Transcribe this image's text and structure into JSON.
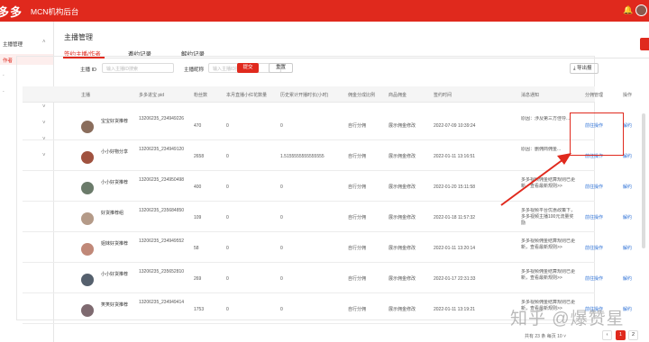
{
  "topbar": {
    "logo": "多多",
    "title": "MCN机构后台",
    "bell_icon": "bell-icon"
  },
  "sidebar": {
    "items": [
      {
        "label": "主播管理",
        "active": false,
        "chevron": "^"
      },
      {
        "label": "作者",
        "active": true,
        "chevron": ""
      },
      {
        "label": "",
        "active": false,
        "chevron": ""
      },
      {
        "label": "",
        "active": false,
        "chevron": ""
      },
      {
        "label": "",
        "active": false,
        "chevron": "v"
      },
      {
        "label": "",
        "active": false,
        "chevron": "v"
      },
      {
        "label": "",
        "active": false,
        "chevron": "v"
      },
      {
        "label": "",
        "active": false,
        "chevron": "v"
      }
    ]
  },
  "page": {
    "title": "主播管理"
  },
  "tabs": [
    "签约主播/作者",
    "邀约记录",
    "解约记录"
  ],
  "filters": {
    "id_label": "主播 ID",
    "id_placeholder": "输入主播ID搜索",
    "nick_label": "主播昵称",
    "nick_placeholder": "输入主播ID搜索",
    "submit": "提交",
    "reset": "重置",
    "export": "导出报"
  },
  "table": {
    "headers": [
      "主播",
      "多多进宝 pid",
      "粉丝数",
      "本月直播小红花数量",
      "历史累计开播时长(小时)",
      "佣金分成比例",
      "商品佣金",
      "签约时间",
      "消息通知",
      "分佣管理",
      "操作"
    ],
    "rows": [
      {
        "name": "宝宝好货推荐",
        "pid": "13206235_234949226",
        "fans": "470",
        "flowers": "0",
        "hours": "0",
        "ratio": "自行分佣",
        "commission": "展示佣金修改",
        "time": "2022-07-09 10:39:24",
        "notice": "原因：涉及第三方佳导...",
        "manage": "前往操作",
        "op": "解约",
        "avatar": "#8a6d5c"
      },
      {
        "name": "小小好物分享",
        "pid": "13206235_234949120",
        "fans": "2658",
        "flowers": "0",
        "hours": "1.5155555555555555",
        "ratio": "自行分佣",
        "commission": "展示佣金修改",
        "time": "2022-01-11 13:16:51",
        "notice": "原因：删佣商佣金...",
        "manage": "前往操作",
        "op": "解约",
        "avatar": "#a0523f"
      },
      {
        "name": "小小好货推荐",
        "pid": "13206235_234950498",
        "fans": "400",
        "flowers": "0",
        "hours": "0",
        "ratio": "自行分佣",
        "commission": "展示佣金修改",
        "time": "2022-01-20 15:11:58",
        "notice": "多多视频佣金结算规则已更新，查看最新规则>>",
        "manage": "前往操作",
        "op": "解约",
        "avatar": "#6b7b6a"
      },
      {
        "name": "好货推荐组",
        "pid": "13206235_235684850",
        "fans": "109",
        "flowers": "0",
        "hours": "0",
        "ratio": "自行分佣",
        "commission": "展示佣金修改",
        "time": "2022-01-18 11:57:32",
        "notice": "多多视频平台优惠政策下，多多视频主播100元流量奖励",
        "manage": "前往操作",
        "op": "解约",
        "avatar": "#b49a88"
      },
      {
        "name": "姐妹好货推荐",
        "pid": "13206235_234949552",
        "fans": "58",
        "flowers": "0",
        "hours": "0",
        "ratio": "自行分佣",
        "commission": "展示佣金修改",
        "time": "2022-01-11 13:20:14",
        "notice": "多多视频佣金结算规则已更新，查看最新规则>>",
        "manage": "前往操作",
        "op": "解约",
        "avatar": "#c08878"
      },
      {
        "name": "小小好货推荐",
        "pid": "13206235_235652810",
        "fans": "269",
        "flowers": "0",
        "hours": "0",
        "ratio": "自行分佣",
        "commission": "展示佣金修改",
        "time": "2022-01-17 22:31:33",
        "notice": "多多视频佣金结算规则已更新，查看最新规则>>",
        "manage": "前往操作",
        "op": "解约",
        "avatar": "#55606d"
      },
      {
        "name": "笑笑好货推荐",
        "pid": "13206235_234949414",
        "fans": "1753",
        "flowers": "0",
        "hours": "0",
        "ratio": "自行分佣",
        "commission": "展示佣金修改",
        "time": "2022-01-11 13:19:21",
        "notice": "多多视频佣金结算规则已更新，查看最新规则>>",
        "manage": "前往操作",
        "op": "解约",
        "avatar": "#7e6a70"
      }
    ]
  },
  "pagination": {
    "total": "共有 23 条",
    "per_page_label": "每页",
    "per_page": "10",
    "pages": [
      "1",
      "2"
    ]
  },
  "watermark": "知乎 @爆赞星"
}
